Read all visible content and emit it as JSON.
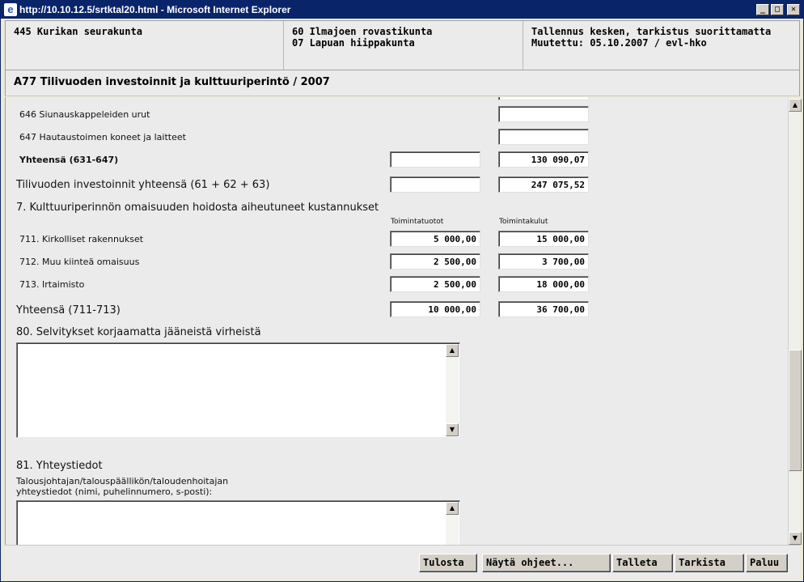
{
  "window": {
    "title": "http://10.10.12.5/srtktal20.html - Microsoft Internet Explorer",
    "min": "_",
    "max": "□",
    "close": "✕"
  },
  "header": {
    "col1_line1": "445 Kurikan seurakunta",
    "col2_line1": "60 Ilmajoen rovastikunta",
    "col2_line2": "07 Lapuan hiippakunta",
    "col3_line1": "Tallennus kesken, tarkistus suorittamatta",
    "col3_line2": "Muutettu: 05.10.2007 / evl-hko"
  },
  "form_title": "A77 Tilivuoden investoinnit ja kulttuuriperintö / 2007",
  "rows": {
    "r646_label": "646 Siunauskappeleiden urut",
    "r646_b": "",
    "r647_label": "647 Hautaustoimen koneet ja laitteet",
    "r647_b": "",
    "total631_label": "Yhteensä (631-647)",
    "total631_a": "",
    "total631_b": "130 090,07",
    "invtotal_label": "Tilivuoden investoinnit yhteensä (61 + 62 + 63)",
    "invtotal_a": "",
    "invtotal_b": "247 075,52"
  },
  "section7": {
    "title": "7. Kulttuuriperinnön omaisuuden hoidosta aiheutuneet kustannukset",
    "col_a": "Toimintatuotot",
    "col_b": "Toimintakulut",
    "r711_label": "711. Kirkolliset rakennukset",
    "r711_a": "5 000,00",
    "r711_b": "15 000,00",
    "r712_label": "712. Muu kiinteä omaisuus",
    "r712_a": "2 500,00",
    "r712_b": "3 700,00",
    "r713_label": "713. Irtaimisto",
    "r713_a": "2 500,00",
    "r713_b": "18 000,00",
    "total_label": "Yhteensä (711-713)",
    "total_a": "10 000,00",
    "total_b": "36 700,00"
  },
  "section80": {
    "title": "80. Selvitykset korjaamatta jääneistä virheistä"
  },
  "section81": {
    "title": "81. Yhteystiedot",
    "sub1": "Talousjohtajan/talouspäällikön/taloudenhoitajan",
    "sub2": "yhteystiedot (nimi, puhelinnumero, s-posti):"
  },
  "buttons": {
    "print": "Tulosta",
    "help": "Näytä ohjeet...",
    "save": "Talleta",
    "check": "Tarkista",
    "back": "Paluu"
  },
  "icons": {
    "up": "▲",
    "down": "▼"
  }
}
